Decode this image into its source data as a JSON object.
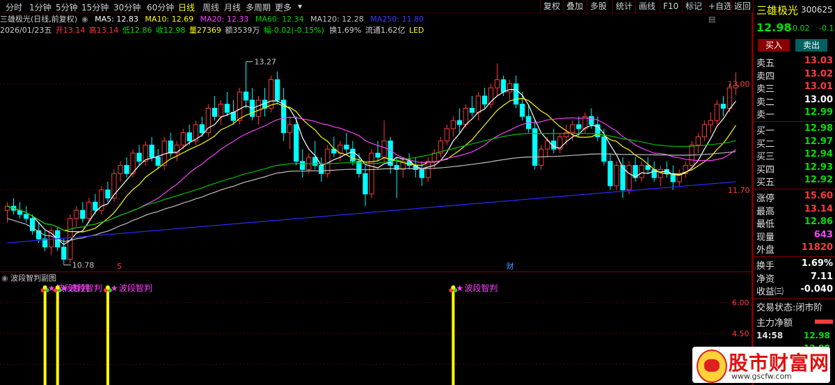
{
  "toolbar": {
    "periods": [
      "分时",
      "1分钟",
      "5分钟",
      "15分钟",
      "30分钟",
      "60分钟",
      "日线",
      "周线",
      "月线",
      "多周期",
      "更多"
    ],
    "active": "日线",
    "right_buttons": [
      "复权",
      "叠加",
      "多股",
      "统计",
      "画线",
      "F10",
      "标记",
      "+自选",
      "返回"
    ]
  },
  "info": {
    "stock": "三雄极光(日线,前复权)",
    "ma5": "MA5: 12.83",
    "ma10": "MA10: 12.69",
    "ma20": "MA20: 12.33",
    "ma60": "MA60: 12.34",
    "ma120": "MA120: 12.28",
    "ma250": "MA250: 11.80",
    "date": "2026/01/23五",
    "open": "开13.14",
    "high": "高13.14",
    "low": "低12.86",
    "close": "收12.98",
    "volume": "量27369",
    "amount": "额3539万",
    "change": "幅-0.02(-0.15%)",
    "turnover": "换1.69%",
    "float": "流通1.62亿",
    "concept": "LED"
  },
  "colors": {
    "up": "#ff3b3b",
    "down": "#00ffff",
    "ma5": "#ffffff",
    "ma10": "#ffff00",
    "ma20": "#ff40ff",
    "ma60": "#00c000",
    "ma120": "#c0c0c0",
    "ma250": "#2a2aff",
    "signal_bar": "#ffff00",
    "signal_text": "#ff40ff"
  },
  "chart_data": {
    "type": "candlestick",
    "ylim": [
      10.7,
      13.6
    ],
    "y_ticks": [
      13.0,
      11.7
    ],
    "y_tick_labels": [
      "13.00",
      "11.70"
    ],
    "annotations": {
      "max_label": "13.27",
      "min_label": "10.78",
      "markers": [
        "S",
        "财",
        "预"
      ]
    },
    "candles": [
      [
        11.45,
        11.55,
        11.3,
        11.5
      ],
      [
        11.5,
        11.6,
        11.4,
        11.45
      ],
      [
        11.45,
        11.55,
        11.35,
        11.4
      ],
      [
        11.4,
        11.5,
        11.3,
        11.35
      ],
      [
        11.35,
        11.4,
        11.15,
        11.2
      ],
      [
        11.2,
        11.3,
        11.05,
        11.1
      ],
      [
        11.1,
        11.2,
        10.95,
        11.0
      ],
      [
        11.0,
        11.25,
        10.9,
        11.2
      ],
      [
        11.2,
        11.25,
        10.95,
        11.0
      ],
      [
        11.0,
        11.1,
        10.78,
        10.85
      ],
      [
        10.85,
        11.4,
        10.8,
        11.35
      ],
      [
        11.35,
        11.5,
        11.25,
        11.45
      ],
      [
        11.45,
        11.55,
        11.3,
        11.35
      ],
      [
        11.35,
        11.6,
        11.3,
        11.55
      ],
      [
        11.55,
        11.65,
        11.4,
        11.45
      ],
      [
        11.45,
        11.75,
        11.4,
        11.7
      ],
      [
        11.7,
        11.8,
        11.55,
        11.6
      ],
      [
        11.6,
        11.95,
        11.55,
        11.9
      ],
      [
        11.9,
        12.05,
        11.8,
        12.0
      ],
      [
        12.0,
        12.1,
        11.85,
        11.9
      ],
      [
        11.9,
        12.2,
        11.85,
        12.15
      ],
      [
        12.15,
        12.25,
        12.0,
        12.05
      ],
      [
        12.05,
        12.3,
        12.0,
        12.25
      ],
      [
        12.25,
        12.35,
        12.05,
        12.1
      ],
      [
        12.1,
        12.2,
        11.95,
        12.0
      ],
      [
        12.0,
        12.35,
        11.95,
        12.3
      ],
      [
        12.3,
        12.4,
        12.1,
        12.15
      ],
      [
        12.15,
        12.3,
        12.05,
        12.25
      ],
      [
        12.25,
        12.45,
        12.2,
        12.4
      ],
      [
        12.4,
        12.5,
        12.25,
        12.3
      ],
      [
        12.3,
        12.55,
        12.25,
        12.5
      ],
      [
        12.5,
        12.6,
        12.35,
        12.4
      ],
      [
        12.4,
        12.75,
        12.35,
        12.7
      ],
      [
        12.7,
        12.85,
        12.55,
        12.6
      ],
      [
        12.6,
        12.8,
        12.5,
        12.75
      ],
      [
        12.75,
        12.9,
        12.6,
        12.65
      ],
      [
        12.65,
        12.8,
        12.5,
        12.55
      ],
      [
        12.55,
        12.95,
        12.5,
        12.9
      ],
      [
        12.9,
        13.27,
        12.7,
        12.8
      ],
      [
        12.8,
        12.95,
        12.55,
        12.6
      ],
      [
        12.6,
        12.85,
        12.5,
        12.8
      ],
      [
        12.8,
        12.95,
        12.6,
        12.7
      ],
      [
        12.7,
        13.1,
        12.65,
        13.05
      ],
      [
        13.05,
        13.15,
        12.75,
        12.8
      ],
      [
        12.8,
        12.95,
        12.3,
        12.4
      ],
      [
        12.4,
        12.6,
        12.2,
        12.5
      ],
      [
        12.5,
        12.6,
        12.0,
        12.05
      ],
      [
        12.05,
        12.2,
        11.85,
        11.95
      ],
      [
        11.95,
        12.15,
        11.9,
        12.1
      ],
      [
        12.1,
        12.3,
        11.95,
        12.0
      ],
      [
        12.0,
        12.1,
        11.8,
        11.9
      ],
      [
        11.9,
        12.25,
        11.85,
        12.2
      ],
      [
        12.2,
        12.35,
        12.1,
        12.15
      ],
      [
        12.15,
        12.3,
        12.05,
        12.25
      ],
      [
        12.25,
        12.4,
        12.15,
        12.2
      ],
      [
        12.2,
        12.3,
        12.0,
        12.05
      ],
      [
        12.05,
        12.15,
        11.85,
        11.9
      ],
      [
        11.9,
        12.0,
        11.5,
        11.65
      ],
      [
        11.65,
        12.2,
        11.6,
        12.15
      ],
      [
        12.15,
        12.3,
        12.05,
        12.1
      ],
      [
        12.1,
        12.55,
        12.05,
        12.3
      ],
      [
        12.3,
        12.35,
        11.9,
        12.0
      ],
      [
        12.0,
        12.1,
        11.6,
        11.95
      ],
      [
        11.95,
        12.1,
        11.85,
        12.05
      ],
      [
        12.05,
        12.15,
        11.95,
        12.0
      ],
      [
        12.0,
        12.1,
        11.85,
        11.95
      ],
      [
        11.95,
        12.05,
        11.75,
        11.85
      ],
      [
        11.85,
        12.1,
        11.8,
        12.05
      ],
      [
        12.05,
        12.2,
        11.95,
        12.15
      ],
      [
        12.15,
        12.35,
        12.1,
        12.3
      ],
      [
        12.3,
        12.5,
        12.25,
        12.45
      ],
      [
        12.45,
        12.6,
        12.35,
        12.55
      ],
      [
        12.55,
        12.7,
        12.4,
        12.5
      ],
      [
        12.5,
        12.75,
        12.45,
        12.7
      ],
      [
        12.7,
        12.85,
        12.6,
        12.65
      ],
      [
        12.65,
        12.9,
        12.55,
        12.85
      ],
      [
        12.85,
        12.95,
        12.7,
        12.75
      ],
      [
        12.75,
        13.0,
        12.7,
        12.95
      ],
      [
        12.95,
        13.25,
        12.85,
        13.05
      ],
      [
        13.05,
        13.1,
        12.85,
        12.9
      ],
      [
        12.9,
        13.05,
        12.8,
        13.0
      ],
      [
        13.0,
        13.1,
        12.7,
        12.75
      ],
      [
        12.75,
        12.9,
        12.55,
        12.6
      ],
      [
        12.6,
        12.75,
        12.4,
        12.45
      ],
      [
        12.45,
        12.55,
        11.95,
        12.0
      ],
      [
        12.0,
        12.25,
        11.95,
        12.2
      ],
      [
        12.2,
        12.35,
        12.1,
        12.3
      ],
      [
        12.3,
        12.45,
        12.15,
        12.2
      ],
      [
        12.2,
        12.4,
        12.15,
        12.35
      ],
      [
        12.35,
        12.5,
        12.25,
        12.4
      ],
      [
        12.4,
        12.55,
        12.3,
        12.5
      ],
      [
        12.5,
        12.6,
        12.35,
        12.45
      ],
      [
        12.45,
        12.65,
        12.4,
        12.6
      ],
      [
        12.6,
        12.7,
        12.45,
        12.5
      ],
      [
        12.5,
        12.6,
        12.3,
        12.35
      ],
      [
        12.35,
        12.45,
        12.0,
        12.05
      ],
      [
        12.05,
        12.15,
        11.7,
        11.75
      ],
      [
        11.75,
        12.05,
        11.7,
        12.0
      ],
      [
        12.0,
        12.1,
        11.6,
        11.7
      ],
      [
        11.7,
        12.05,
        11.65,
        12.0
      ],
      [
        12.0,
        12.1,
        11.8,
        11.85
      ],
      [
        11.85,
        12.05,
        11.8,
        12.0
      ],
      [
        12.0,
        12.1,
        11.9,
        11.95
      ],
      [
        11.95,
        12.05,
        11.8,
        11.85
      ],
      [
        11.85,
        12.0,
        11.75,
        11.95
      ],
      [
        11.95,
        12.05,
        11.85,
        11.9
      ],
      [
        11.9,
        12.0,
        11.7,
        11.8
      ],
      [
        11.8,
        11.95,
        11.75,
        11.9
      ],
      [
        11.9,
        12.05,
        11.85,
        12.0
      ],
      [
        12.0,
        12.3,
        11.95,
        12.25
      ],
      [
        12.25,
        12.4,
        12.15,
        12.35
      ],
      [
        12.35,
        12.55,
        12.3,
        12.5
      ],
      [
        12.5,
        12.65,
        12.4,
        12.55
      ],
      [
        12.55,
        12.8,
        12.5,
        12.75
      ],
      [
        12.75,
        12.85,
        12.6,
        12.7
      ],
      [
        12.7,
        13.0,
        12.65,
        12.95
      ],
      [
        12.95,
        13.14,
        12.86,
        12.98
      ]
    ],
    "signals": {
      "title": "波段智判副图",
      "label": "波段智判",
      "ylim": [
        2.0,
        7.0
      ],
      "y_ticks": [
        "6.00",
        "4.50",
        "3.00"
      ],
      "positions": [
        6,
        8,
        16,
        71
      ]
    }
  },
  "quote": {
    "name": "三雄极光",
    "code": "300625",
    "price": "12.98",
    "change": "-0.02",
    "pct": "-0.1",
    "buy_btn": "买入",
    "sell_btn": "卖出",
    "asks": [
      [
        "卖五",
        "13.03"
      ],
      [
        "卖四",
        "13.02"
      ],
      [
        "卖三",
        "13.01"
      ],
      [
        "卖二",
        "13.00"
      ],
      [
        "卖一",
        "12.99"
      ]
    ],
    "bids": [
      [
        "买一",
        "12.98"
      ],
      [
        "买二",
        "12.97"
      ],
      [
        "买三",
        "12.94"
      ],
      [
        "买四",
        "12.93"
      ],
      [
        "买五",
        "12.92"
      ]
    ],
    "stats": [
      [
        "涨停",
        "15.60"
      ],
      [
        "最高",
        "13.14"
      ],
      [
        "最低",
        "12.86"
      ],
      [
        "现量",
        "643"
      ],
      [
        "外盘",
        "11820"
      ]
    ],
    "stats2": [
      [
        "换手",
        "1.69%"
      ],
      [
        "净资",
        "7.11"
      ],
      [
        "收益㈢",
        "-0.040"
      ]
    ],
    "trade_status": "交易状态:闭市阶",
    "main_flow": "主力净额",
    "ticks": [
      [
        "14:58",
        "12.98"
      ],
      [
        "",
        "12.98"
      ]
    ]
  },
  "watermark": {
    "text": "股市财富网",
    "url": "www.gscfw.com"
  }
}
